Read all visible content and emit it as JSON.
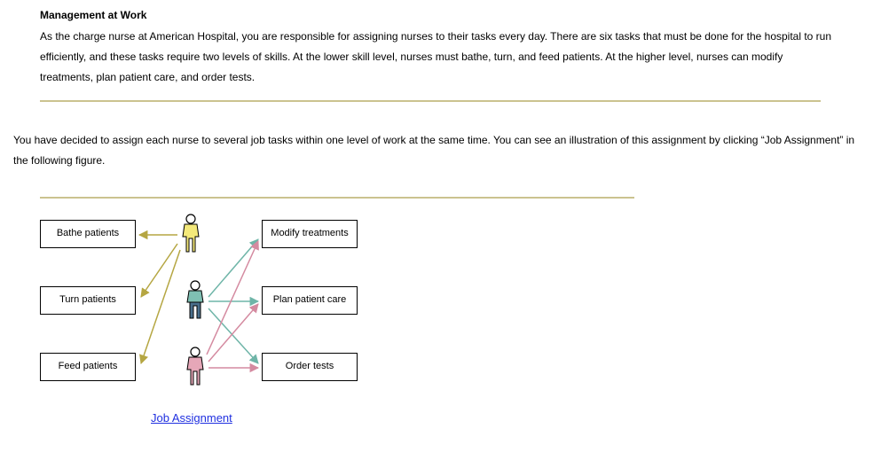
{
  "heading": "Management at Work",
  "para1": "As the charge nurse at American Hospital, you are responsible for assigning nurses to their tasks every day. There are six tasks that must be done for the hospital to run efficiently, and these tasks require two levels of skills. At the lower skill level, nurses must bathe, turn, and feed patients. At the higher level, nurses can modify treatments, plan patient care, and order tests.",
  "para2": "You have decided to assign each nurse to several job tasks within one level of work at the same time. You can see an illustration of this assignment by clicking “Job Assignment” in the following figure.",
  "diagram": {
    "left_tasks": [
      "Bathe patients",
      "Turn patients",
      "Feed patients"
    ],
    "right_tasks": [
      "Modify treatments",
      "Plan patient care",
      "Order tests"
    ],
    "nurses": [
      {
        "name": "nurse-yellow",
        "shirt": "#f4e97a",
        "pants": "#f4e97a"
      },
      {
        "name": "nurse-teal",
        "shirt": "#7fbfb3",
        "pants": "#4a6f8c"
      },
      {
        "name": "nurse-pink",
        "shirt": "#e6a7b8",
        "pants": "#e6a7b8"
      }
    ],
    "link_label": "Job Assignment"
  }
}
